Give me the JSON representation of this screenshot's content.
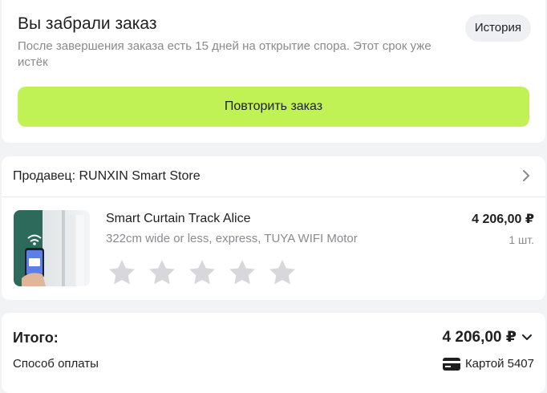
{
  "order_status": {
    "title": "Вы забрали заказ",
    "description": "После завершения заказа есть 15 дней на открытие спора. Этот срок уже истёк",
    "history_label": "История",
    "repeat_label": "Повторить заказ",
    "accent_color": "#c0f256"
  },
  "seller": {
    "label": "Продавец: RUNXIN Smart Store",
    "icon": "chevron-right-icon"
  },
  "product": {
    "name": "Smart Curtain Track Alice",
    "variant": "322cm wide or less, express, TUYA WIFI Motor",
    "price": "4 206,00 ₽",
    "quantity": "1 шт.",
    "rating_stars_total": 5,
    "rating_selected": 0
  },
  "summary": {
    "total_label": "Итого:",
    "total_value": "4 206,00 ₽",
    "payment_label": "Способ оплаты",
    "payment_method": "Картой 5407",
    "payment_icon": "credit-card-icon"
  }
}
